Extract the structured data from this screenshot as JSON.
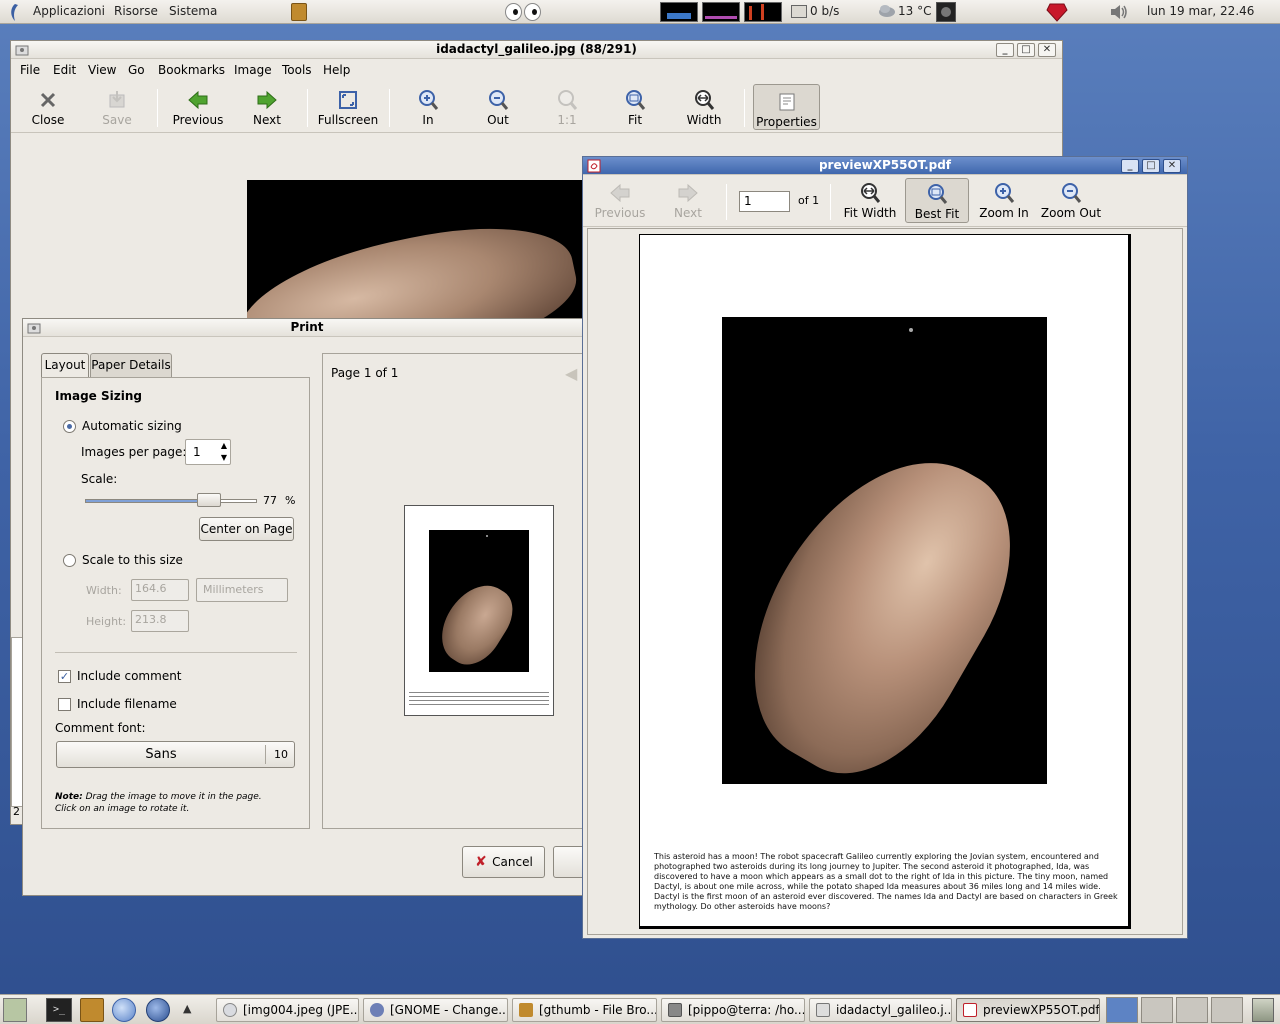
{
  "top_panel": {
    "menus": [
      "Applicazioni",
      "Risorse",
      "Sistema"
    ],
    "net_speed": "0 b/s",
    "temperature": "13 °C",
    "clock": "lun 19 mar, 22.46"
  },
  "gthumb": {
    "title": "idadactyl_galileo.jpg  (88/291)",
    "menu": [
      "File",
      "Edit",
      "View",
      "Go",
      "Bookmarks",
      "Image",
      "Tools",
      "Help"
    ],
    "toolbar": {
      "close": "Close",
      "save": "Save",
      "previous": "Previous",
      "next": "Next",
      "fullscreen": "Fullscreen",
      "zoom_in": "In",
      "zoom_out": "Out",
      "actual": "1:1",
      "fit": "Fit",
      "width": "Width",
      "properties": "Properties"
    },
    "status_fragment": "2"
  },
  "print_dialog": {
    "title": "Print",
    "tabs": [
      "Layout",
      "Paper Details"
    ],
    "section_title": "Image Sizing",
    "automatic_sizing": "Automatic sizing",
    "images_per_page_label": "Images per page:",
    "images_per_page_value": "1",
    "scale_label": "Scale:",
    "scale_value": "77",
    "scale_unit": "%",
    "center_button": "Center on Page",
    "scale_to_size": "Scale to this size",
    "width_label": "Width:",
    "width_value": "164.6",
    "units": "Millimeters",
    "height_label": "Height:",
    "height_value": "213.8",
    "include_comment": "Include comment",
    "include_comment_checked": true,
    "include_filename": "Include filename",
    "include_filename_checked": false,
    "comment_font_label": "Comment font:",
    "font_name": "Sans",
    "font_size": "10",
    "note_bold": "Note:",
    "note_text": "Drag the image to move it in the page.",
    "note_text2": "Click on an image to rotate it.",
    "page_label": "Page 1 of 1",
    "cancel": "Cancel"
  },
  "pdf_viewer": {
    "title": "previewXP55OT.pdf",
    "toolbar": {
      "previous": "Previous",
      "next": "Next",
      "page_value": "1",
      "of_pages": "of 1",
      "fit_width": "Fit Width",
      "best_fit": "Best Fit",
      "zoom_in": "Zoom In",
      "zoom_out": "Zoom Out"
    },
    "caption": "This asteroid has a moon! The robot spacecraft Galileo currently exploring the Jovian system, encountered and photographed two asteroids during its long journey to Jupiter. The second asteroid it photographed, Ida, was discovered to have a moon which appears as a small dot to the right of Ida in this picture. The tiny moon, named Dactyl, is about one mile across, while the potato shaped Ida measures about 36 miles long and 14 miles wide. Dactyl is the first moon of an asteroid ever discovered. The names Ida and Dactyl are based on characters in Greek mythology. Do other asteroids have moons?"
  },
  "taskbar": {
    "tasks": [
      "[img004.jpeg (JPE...",
      "[GNOME - Change...",
      "[gthumb - File Bro...",
      "[pippo@terra: /ho...",
      "idadactyl_galileo.j...",
      "previewXP55OT.pdf"
    ]
  },
  "colors": {
    "accent": "#3f67ad",
    "desktop": "#3f63a6",
    "window_bg": "#edeae4"
  }
}
